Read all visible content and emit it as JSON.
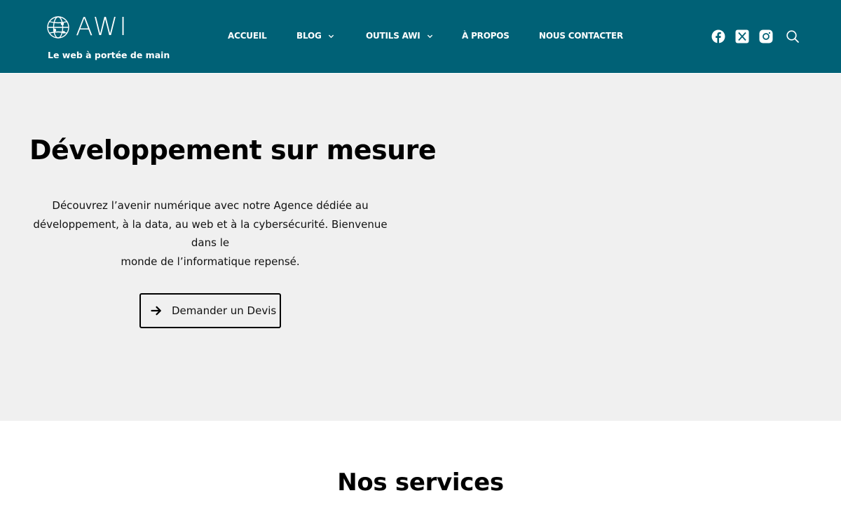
{
  "brand": {
    "name": "AWI",
    "tagline": "Le web à portée de main",
    "header_bg": "#006176",
    "hero_bg": "#f0f0f0"
  },
  "nav": {
    "items": [
      {
        "label": "ACCUEIL",
        "has_dropdown": false
      },
      {
        "label": "BLOG",
        "has_dropdown": true
      },
      {
        "label": "OUTILS AWI",
        "has_dropdown": true
      },
      {
        "label": "À PROPOS",
        "has_dropdown": false
      },
      {
        "label": "NOUS CONTACTER",
        "has_dropdown": false
      }
    ]
  },
  "social": {
    "icons": [
      "facebook-icon",
      "x-icon",
      "instagram-icon",
      "search-icon"
    ]
  },
  "hero": {
    "title": "Développement sur mesure",
    "description_lines": [
      "Découvrez l’avenir numérique avec notre Agence dédiée au",
      "développement, à la data, au web et à la cybersécurité. Bienvenue dans le",
      "monde de l’informatique repensé."
    ],
    "cta_label": "Demander un Devis",
    "cta_icon": "arrow-right-icon"
  },
  "services": {
    "title": "Nos services"
  }
}
